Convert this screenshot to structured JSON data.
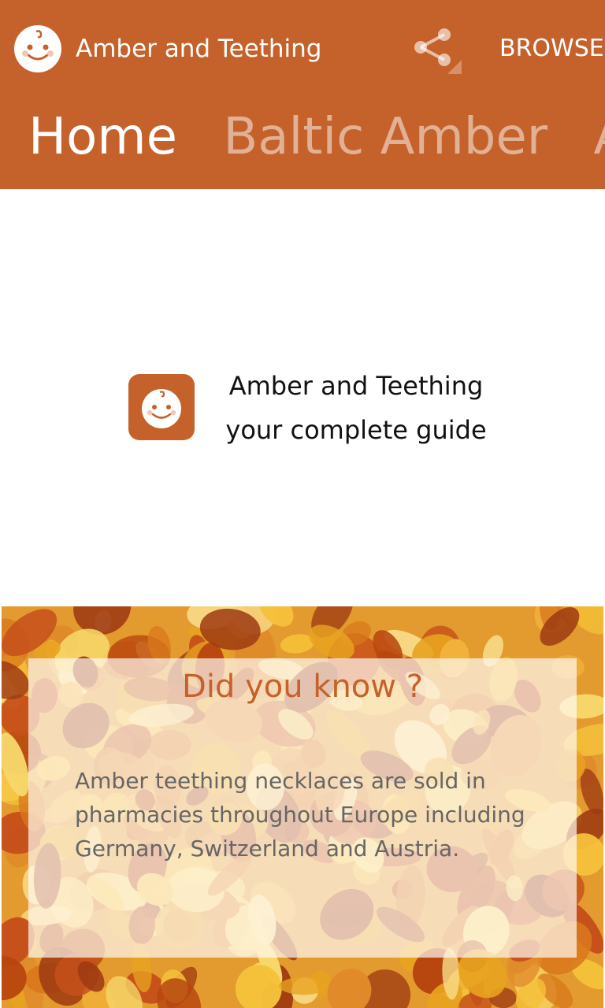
{
  "header": {
    "app_title": "Amber and Teething",
    "browse_label": "BROWSE",
    "background_color": "#c5612a",
    "logo_icon": "baby-face-icon",
    "share_icon": "share-icon"
  },
  "tabs": [
    {
      "label": "Home",
      "active": true
    },
    {
      "label": "Baltic Amber",
      "active": false
    },
    {
      "label": "Am",
      "active": false
    }
  ],
  "hero": {
    "line1": "Amber and Teething",
    "line2": "your complete guide",
    "logo_icon": "baby-face-icon"
  },
  "fact_card": {
    "title": "Did you know ?",
    "body": "Amber teething necklaces are sold in pharmacies throughout Europe including Germany, Switzerland and Austria.",
    "title_color": "#c5612a",
    "background_image": "amber-stones"
  }
}
